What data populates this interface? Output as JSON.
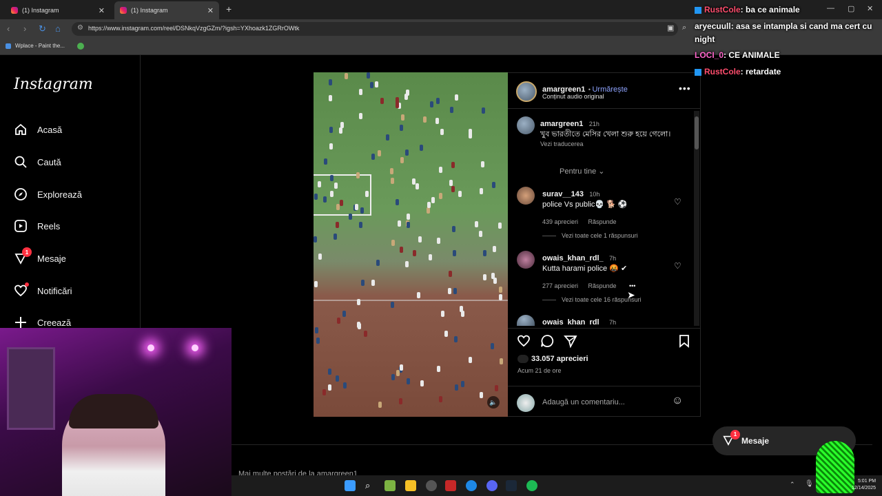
{
  "browser": {
    "tabs": [
      {
        "title": "(1) Instagram"
      },
      {
        "title": "(1) Instagram"
      }
    ],
    "url": "https://www.instagram.com/reel/DSNkqVzgGZm/?igsh=YXhoazk1ZGRrOWtk",
    "bookmarks": [
      {
        "label": "Wplace - Paint the..."
      }
    ]
  },
  "sidebar": {
    "logo": "Instagram",
    "items": [
      {
        "label": "Acasă",
        "icon": "home-icon"
      },
      {
        "label": "Caută",
        "icon": "search-icon"
      },
      {
        "label": "Explorează",
        "icon": "compass-icon"
      },
      {
        "label": "Reels",
        "icon": "reels-icon"
      },
      {
        "label": "Mesaje",
        "icon": "messenger-icon",
        "badge": "1"
      },
      {
        "label": "Notificări",
        "icon": "heart-icon"
      },
      {
        "label": "Creează",
        "icon": "plus-icon"
      }
    ]
  },
  "post": {
    "username": "amargreen1",
    "follow": "Urmărește",
    "audio": "Conținut audio original",
    "caption": {
      "user": "amargreen1",
      "time": "21h",
      "text": "খুব ভারতীতে মেসির খেলা শুরু হয়ে গেলো।",
      "translate": "Vezi traducerea"
    },
    "for_you": "Pentru tine",
    "comments": [
      {
        "user": "surav__143",
        "time": "10h",
        "text": "police Vs public💀 🐕 ⚽",
        "likes": "439 aprecieri",
        "reply": "Răspunde",
        "view_replies": "Vezi toate cele 1 răspunsuri"
      },
      {
        "user": "owais_khan_rdl_",
        "time": "7h",
        "text": "Kutta harami police 🤬 ✔",
        "likes": "277 aprecieri",
        "reply": "Răspunde",
        "view_replies": "Vezi toate cele 16 răspunsuri"
      },
      {
        "user": "owais_khan_rdl_",
        "time": "7h"
      }
    ],
    "like_count": "33.057 aprecieri",
    "posted": "Acum 21 de ore",
    "comment_placeholder": "Adaugă un comentariu..."
  },
  "more_posts": "Mai multe postări de la amargreen1",
  "messages_button": {
    "label": "Mesaje",
    "badge": "1"
  },
  "chat": [
    {
      "user": "RustCole",
      "msg": ": ba ce animale",
      "color": "#ff4d6d",
      "platform": true
    },
    {
      "user": "aryecuull",
      "msg": ": asa se intampla si cand ma cert cu night",
      "color": "#ffffff",
      "platform": false
    },
    {
      "user": "LOCI_0",
      "msg": ": CE ANIMALE",
      "color": "#ff66cc",
      "platform": false
    },
    {
      "user": "RustCole",
      "msg": ": retardate",
      "color": "#ff4d6d",
      "platform": true
    }
  ],
  "clock": {
    "time": "5:01 PM",
    "date": "12/14/2025"
  }
}
